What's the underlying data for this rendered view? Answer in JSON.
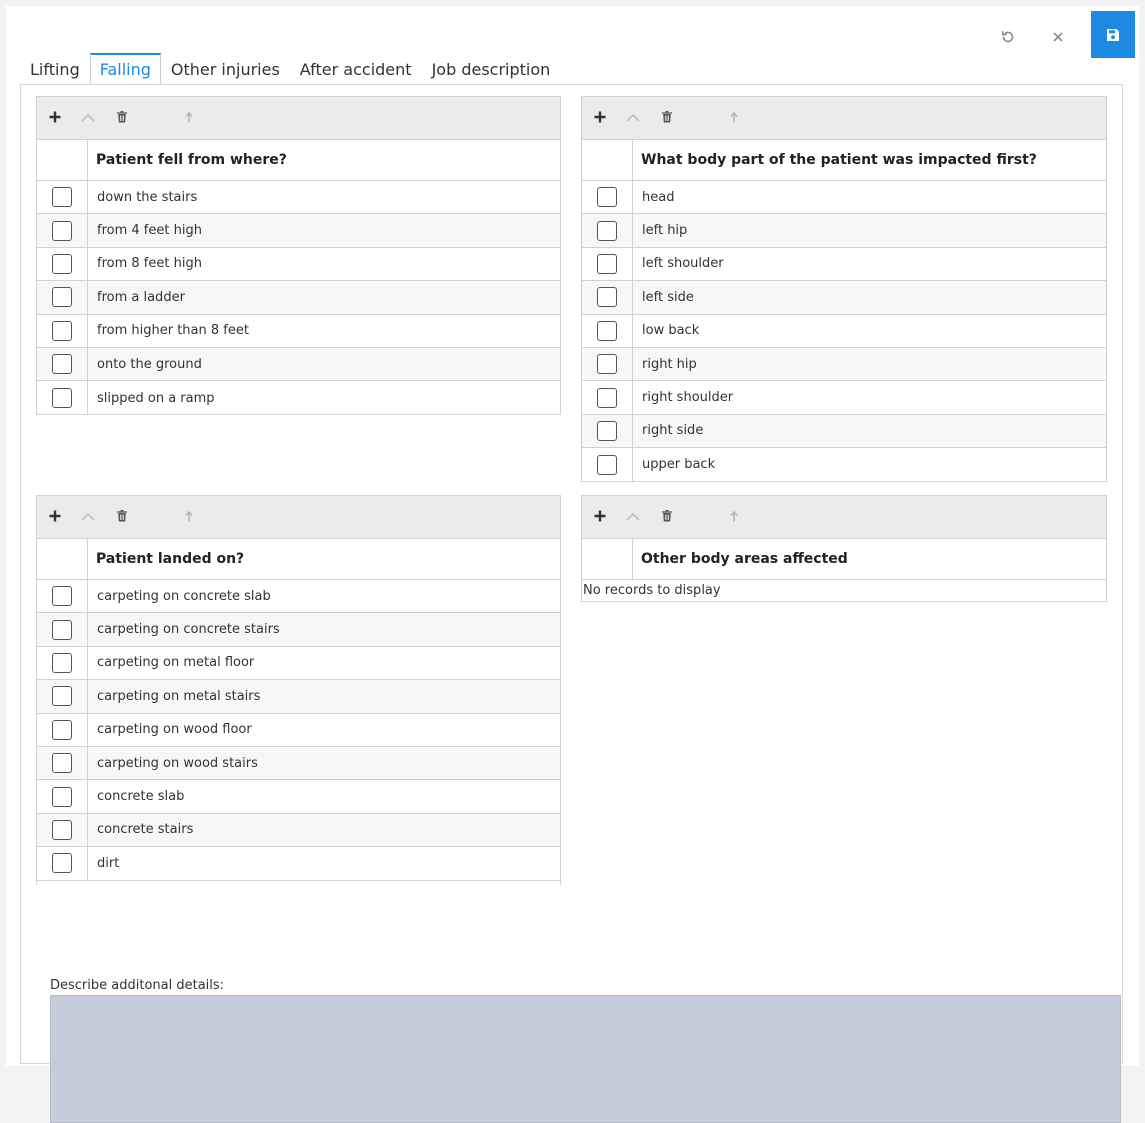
{
  "toolbar": {
    "undo_icon": "undo-icon",
    "close_icon": "close-icon",
    "save_icon": "save-icon",
    "save_color": "#1e88e5"
  },
  "tabs": [
    {
      "label": "Lifting",
      "active": false
    },
    {
      "label": "Falling",
      "active": true
    },
    {
      "label": "Other injuries",
      "active": false
    },
    {
      "label": "After accident",
      "active": false
    },
    {
      "label": "Job description",
      "active": false
    }
  ],
  "grids": {
    "fell_from": {
      "title": "Patient fell from where?",
      "rows": [
        "down the stairs",
        "from 4 feet high",
        "from 8 feet high",
        "from a ladder",
        "from higher than 8 feet",
        "onto the ground",
        "slipped on a ramp"
      ]
    },
    "impacted_first": {
      "title": "What body part of the patient was impacted first?",
      "rows": [
        "head",
        "left hip",
        "left shoulder",
        "left side",
        "low back",
        "right hip",
        "right shoulder",
        "right side",
        "upper back"
      ]
    },
    "landed_on": {
      "title": "Patient landed on?",
      "rows": [
        "carpeting on concrete slab",
        "carpeting on concrete stairs",
        "carpeting on metal floor",
        "carpeting on metal stairs",
        "carpeting on wood floor",
        "carpeting on wood stairs",
        "concrete slab",
        "concrete stairs",
        "dirt"
      ]
    },
    "other_areas": {
      "title": "Other body areas affected",
      "empty_text": "No records to display"
    }
  },
  "details": {
    "label": "Describe additonal details:",
    "value": ""
  }
}
